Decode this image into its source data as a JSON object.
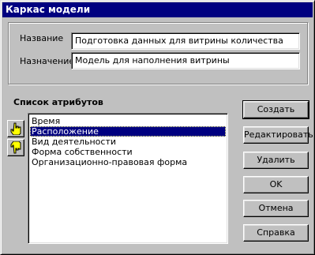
{
  "window": {
    "title": "Каркас модели"
  },
  "form": {
    "name_label": "Название",
    "name_value": "Подготовка данных для витрины количества",
    "purpose_label": "Назначение",
    "purpose_value": "Модель для наполнения витрины"
  },
  "attributes": {
    "title": "Список атрибутов",
    "items": [
      "Время",
      "Расположение",
      "Вид деятельности",
      "Форма собственности",
      "Организационно-правовая форма"
    ],
    "selected_item": "Расположение"
  },
  "buttons": {
    "create": "Создать",
    "edit": "Редактировать",
    "delete": "Удалить",
    "ok": "OK",
    "cancel": "Отмена",
    "help": "Справка"
  },
  "icons": {
    "move_up": "hand-pointing-up-icon",
    "move_down": "hand-pointing-down-icon"
  },
  "colors": {
    "titlebar": "#000080",
    "selection": "#000080",
    "face": "#c0c0c0"
  }
}
